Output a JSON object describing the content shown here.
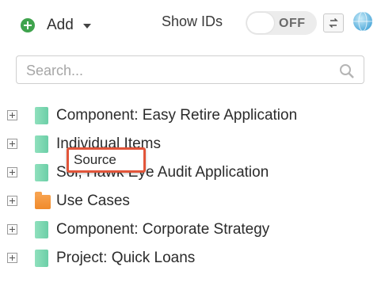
{
  "toolbar": {
    "add_label": "Add",
    "show_ids_label": "Show IDs",
    "toggle_state": "OFF",
    "add_icon": "plus-circle-icon",
    "swap_icon": "swap-icon",
    "globe_icon": "globe-icon"
  },
  "search": {
    "placeholder": "Search..."
  },
  "tree": {
    "items": [
      {
        "label": "Component: Easy Retire Application",
        "icon": "component-icon",
        "color": "#6ccfa7"
      },
      {
        "label": "Individual Items",
        "icon": "component-icon",
        "color": "#6ccfa7"
      },
      {
        "label": "Sol, Hawk Eye Audit Application",
        "icon": "component-icon",
        "color": "#6ccfa7"
      },
      {
        "label": "Use Cases",
        "icon": "folder-icon",
        "color": "#f08a2a"
      },
      {
        "label": "Component: Corporate Strategy",
        "icon": "component-icon",
        "color": "#6ccfa7"
      },
      {
        "label": "Project: Quick Loans",
        "icon": "component-icon",
        "color": "#6ccfa7"
      }
    ]
  },
  "tooltip": {
    "text": "Source",
    "border_color": "#e2553a"
  },
  "colors": {
    "accent_green": "#3fa34d",
    "teal": "#6ccfa7",
    "orange": "#f08a2a"
  }
}
